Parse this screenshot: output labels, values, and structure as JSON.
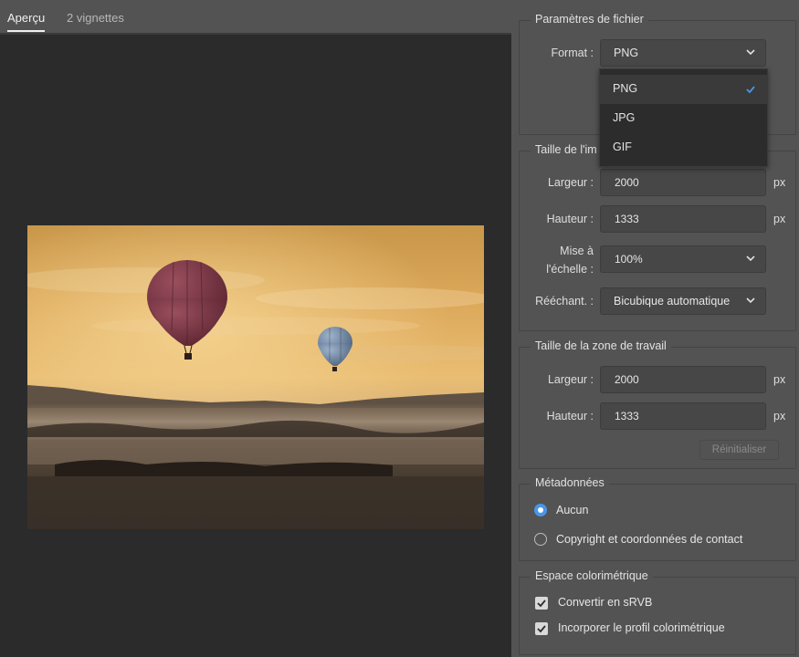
{
  "tabs": {
    "preview": "Aperçu",
    "thumbs": "2 vignettes"
  },
  "file_settings": {
    "title": "Paramètres de fichier",
    "format_label": "Format :",
    "format_value": "PNG",
    "format_options": [
      "PNG",
      "JPG",
      "GIF"
    ]
  },
  "image_size": {
    "title": "Taille de l'image",
    "title_visible": "Taille de l'im",
    "width_label": "Largeur :",
    "width_value": "2000",
    "height_label": "Hauteur :",
    "height_value": "1333",
    "scale_label_line1": "Mise à",
    "scale_label_line2": "l'échelle :",
    "scale_value": "100%",
    "resample_label": "Rééchant. :",
    "resample_value": "Bicubique automatique",
    "unit": "px"
  },
  "canvas_size": {
    "title": "Taille de la zone de travail",
    "width_label": "Largeur :",
    "width_value": "2000",
    "height_label": "Hauteur :",
    "height_value": "1333",
    "unit": "px",
    "reset_label": "Réinitialiser"
  },
  "metadata": {
    "title": "Métadonnées",
    "options": [
      "Aucun",
      "Copyright et coordonnées de contact"
    ],
    "selected": "Aucun"
  },
  "color_space": {
    "title": "Espace colorimétrique",
    "convert_label": "Convertir en sRVB",
    "convert_checked": true,
    "embed_label": "Incorporer le profil colorimétrique",
    "embed_checked": true
  },
  "colors": {
    "accent": "#4a95e8",
    "panel": "#535353",
    "preview_bg": "#2b2b2b"
  }
}
